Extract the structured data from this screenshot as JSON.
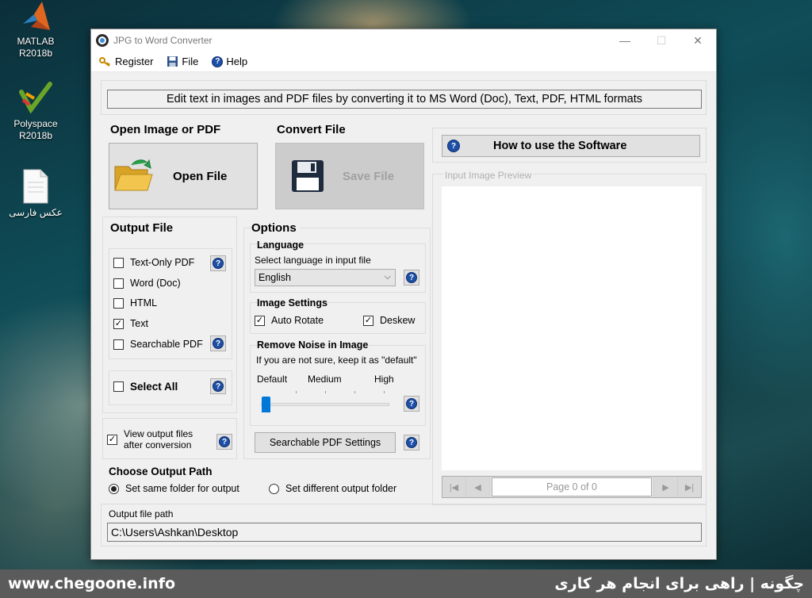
{
  "desktop": {
    "icons": [
      {
        "label": "MATLAB R2018b",
        "icon": "matlab-icon"
      },
      {
        "label": "Polyspace R2018b",
        "icon": "polyspace-icon"
      },
      {
        "label": "عکس فارسی",
        "icon": "document-icon"
      }
    ]
  },
  "window": {
    "title": "JPG to Word Converter",
    "controls": {
      "minimize": "—",
      "maximize": "☐",
      "close": "✕"
    }
  },
  "menu": {
    "items": [
      {
        "label": "Register",
        "icon": "key-icon"
      },
      {
        "label": "File",
        "icon": "floppy-disk-icon"
      },
      {
        "label": "Help",
        "icon": "help-icon"
      }
    ]
  },
  "banner": "Edit text in images and PDF files by converting it to MS Word (Doc), Text, PDF, HTML formats",
  "open_section": {
    "heading": "Open Image or PDF",
    "button": "Open File"
  },
  "convert_section": {
    "heading": "Convert File",
    "button": "Save File"
  },
  "how_to_button": "How to use the Software",
  "preview": {
    "label": "Input Image Preview",
    "page_text": "Page 0 of 0"
  },
  "output_file": {
    "heading": "Output File",
    "options": [
      {
        "label": "Text-Only PDF",
        "checked": false,
        "help": true
      },
      {
        "label": "Word (Doc)",
        "checked": false,
        "help": false
      },
      {
        "label": "HTML",
        "checked": false,
        "help": false
      },
      {
        "label": "Text",
        "checked": true,
        "help": false
      },
      {
        "label": "Searchable PDF",
        "checked": false,
        "help": true
      }
    ],
    "select_all": "Select All",
    "view_output": {
      "line1": "View output files",
      "line2": "after conversion",
      "checked": true
    }
  },
  "options": {
    "heading": "Options",
    "language": {
      "title": "Language",
      "hint": "Select language in input file",
      "selected": "English"
    },
    "image_settings": {
      "title": "Image Settings",
      "auto_rotate": {
        "label": "Auto Rotate",
        "checked": true
      },
      "deskew": {
        "label": "Deskew",
        "checked": true
      }
    },
    "noise": {
      "title": "Remove Noise in Image",
      "hint": "If you are not sure, keep it as \"default\"",
      "levels": [
        "Default",
        "Medium",
        "High"
      ],
      "selected_level": "Default"
    },
    "searchable_pdf_button": "Searchable PDF Settings"
  },
  "output_path": {
    "heading": "Choose Output Path",
    "same_folder": "Set same folder for output",
    "different_folder": "Set different output folder",
    "selected": "same",
    "path_label": "Output file path",
    "path_value": "C:\\Users\\Ashkan\\Desktop"
  },
  "footer": {
    "left": "www.chegoone.info",
    "right": "چگونه | راهی برای انجام هر کاری"
  },
  "colors": {
    "accent": "#0078d7",
    "help_blue": "#1d4fa6",
    "footer_bg": "#5b5b5b"
  }
}
